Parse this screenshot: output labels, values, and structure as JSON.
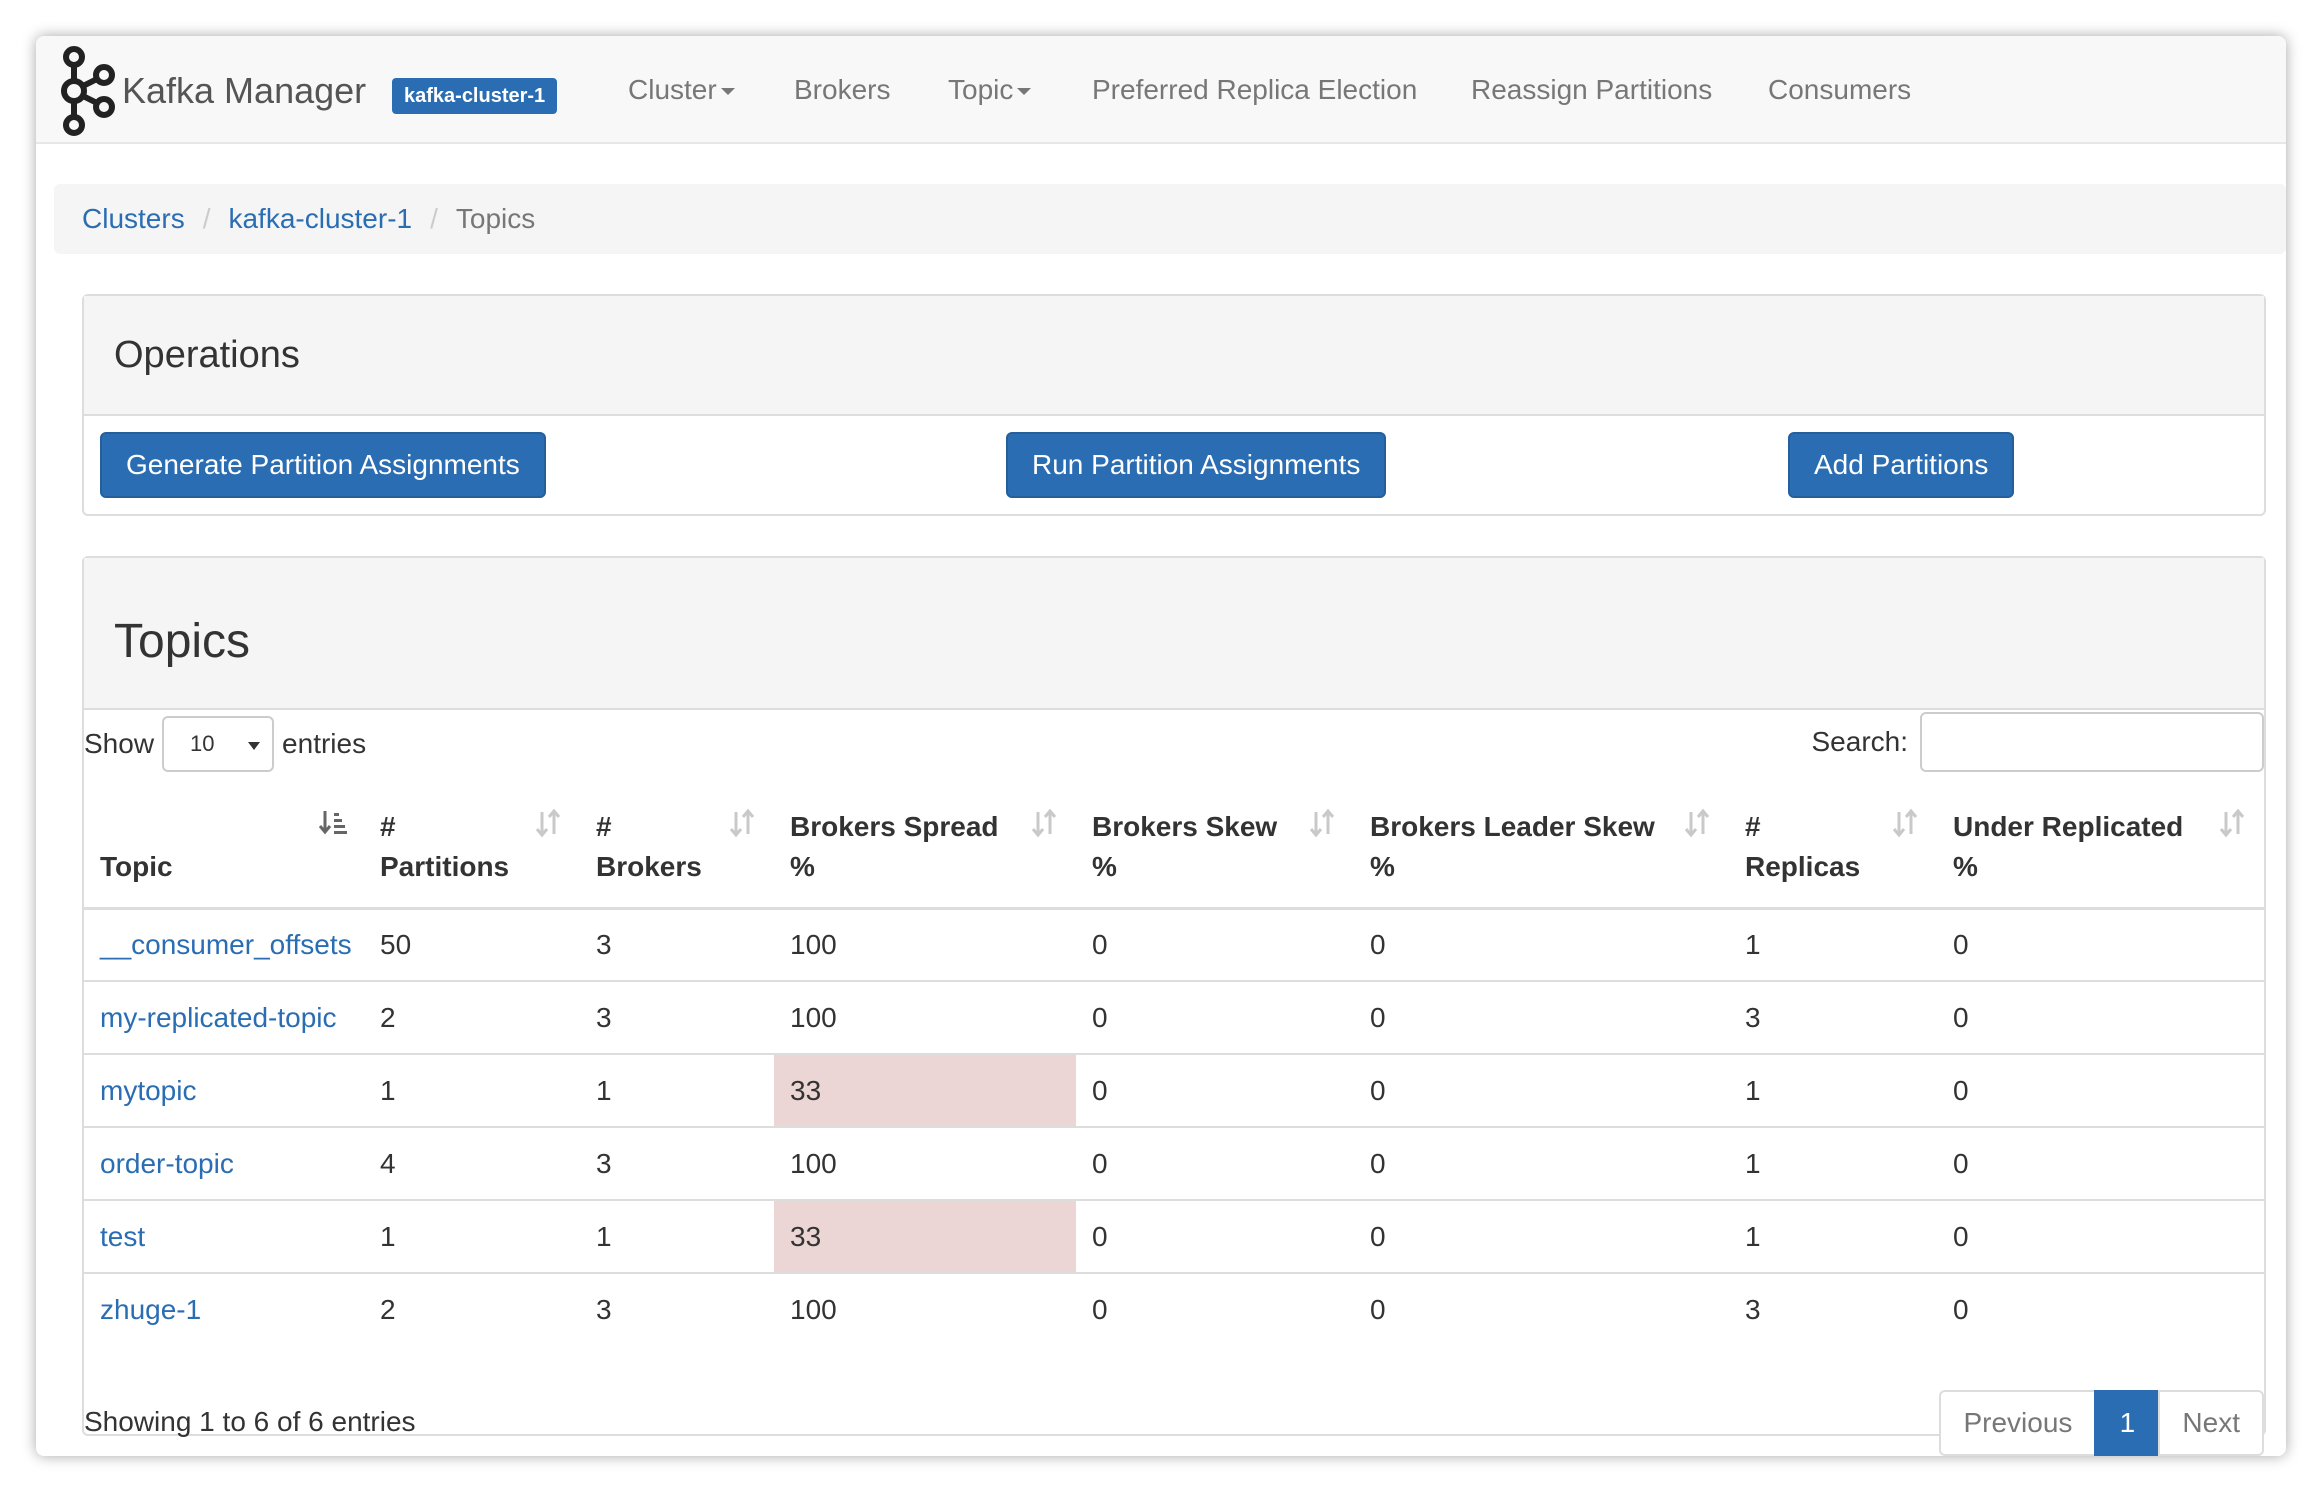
{
  "navbar": {
    "brand": "Kafka Manager",
    "cluster_badge": "kafka-cluster-1",
    "items": [
      {
        "label": "Cluster",
        "dropdown": true
      },
      {
        "label": "Brokers",
        "dropdown": false
      },
      {
        "label": "Topic",
        "dropdown": true
      },
      {
        "label": "Preferred Replica Election",
        "dropdown": false
      },
      {
        "label": "Reassign Partitions",
        "dropdown": false
      },
      {
        "label": "Consumers",
        "dropdown": false
      }
    ]
  },
  "breadcrumb": {
    "items": [
      "Clusters",
      "kafka-cluster-1",
      "Topics"
    ],
    "separator": "/"
  },
  "operations": {
    "title": "Operations",
    "buttons": [
      "Generate Partition Assignments",
      "Run Partition Assignments",
      "Add Partitions"
    ]
  },
  "topics": {
    "title": "Topics",
    "length_label_before": "Show",
    "length_value": "10",
    "length_label_after": "entries",
    "search_label": "Search:",
    "search_value": "",
    "columns": [
      {
        "line1": "",
        "line2": "Topic"
      },
      {
        "line1": "#",
        "line2": "Partitions"
      },
      {
        "line1": "#",
        "line2": "Brokers"
      },
      {
        "line1": "Brokers Spread",
        "line2": "%"
      },
      {
        "line1": "Brokers Skew",
        "line2": "%"
      },
      {
        "line1": "Brokers Leader Skew",
        "line2": "%"
      },
      {
        "line1": "#",
        "line2": "Replicas"
      },
      {
        "line1": "Under Replicated",
        "line2": "%"
      }
    ],
    "rows": [
      {
        "topic": "__consumer_offsets",
        "partitions": "50",
        "brokers": "3",
        "spread": "100",
        "skew": "0",
        "leader_skew": "0",
        "replicas": "1",
        "under_replicated": "0",
        "spread_warning": false
      },
      {
        "topic": "my-replicated-topic",
        "partitions": "2",
        "brokers": "3",
        "spread": "100",
        "skew": "0",
        "leader_skew": "0",
        "replicas": "3",
        "under_replicated": "0",
        "spread_warning": false
      },
      {
        "topic": "mytopic",
        "partitions": "1",
        "brokers": "1",
        "spread": "33",
        "skew": "0",
        "leader_skew": "0",
        "replicas": "1",
        "under_replicated": "0",
        "spread_warning": true
      },
      {
        "topic": "order-topic",
        "partitions": "4",
        "brokers": "3",
        "spread": "100",
        "skew": "0",
        "leader_skew": "0",
        "replicas": "1",
        "under_replicated": "0",
        "spread_warning": false
      },
      {
        "topic": "test",
        "partitions": "1",
        "brokers": "1",
        "spread": "33",
        "skew": "0",
        "leader_skew": "0",
        "replicas": "1",
        "under_replicated": "0",
        "spread_warning": true
      },
      {
        "topic": "zhuge-1",
        "partitions": "2",
        "brokers": "3",
        "spread": "100",
        "skew": "0",
        "leader_skew": "0",
        "replicas": "3",
        "under_replicated": "0",
        "spread_warning": false
      }
    ],
    "info": "Showing 1 to 6 of 6 entries",
    "pagination": {
      "previous": "Previous",
      "current": "1",
      "next": "Next"
    }
  },
  "colors": {
    "primary": "#2a6db3",
    "warning_cell": "#ebd5d5",
    "nav_text": "#777777"
  },
  "icons": {
    "brand": "kafka-logo-icon",
    "sort_active": "sort-ascending-icon",
    "sort": "sort-both-icon",
    "select_arrow": "chevron-down-icon",
    "nav_caret": "caret-down-icon"
  }
}
